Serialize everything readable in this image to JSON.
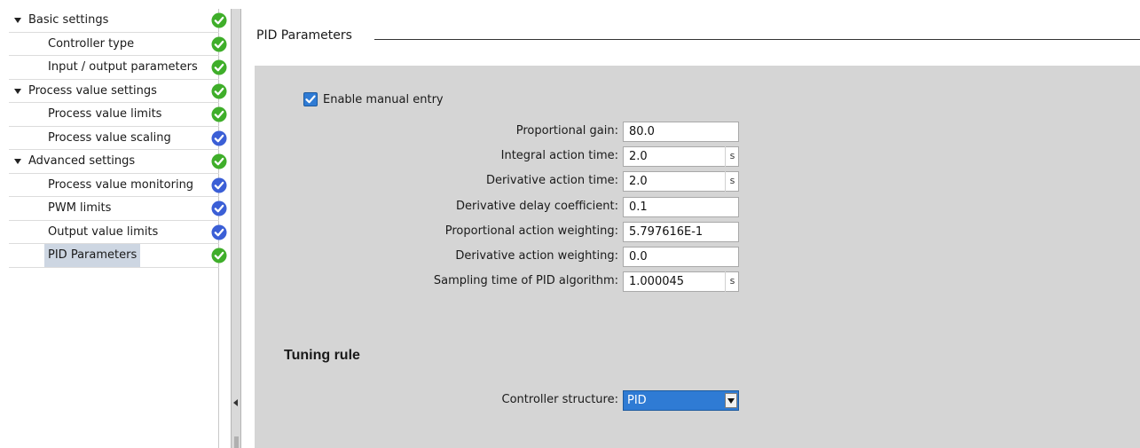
{
  "nav": {
    "items": [
      {
        "label": "Basic settings",
        "level": 0,
        "expanded": true,
        "status": "ok"
      },
      {
        "label": "Controller type",
        "level": 1,
        "status": "ok"
      },
      {
        "label": "Input / output parameters",
        "level": 1,
        "status": "ok"
      },
      {
        "label": "Process value settings",
        "level": 0,
        "expanded": true,
        "status": "ok"
      },
      {
        "label": "Process value limits",
        "level": 1,
        "status": "ok"
      },
      {
        "label": "Process value scaling",
        "level": 1,
        "status": "info"
      },
      {
        "label": "Advanced settings",
        "level": 0,
        "expanded": true,
        "status": "ok"
      },
      {
        "label": "Process value monitoring",
        "level": 1,
        "status": "info"
      },
      {
        "label": "PWM limits",
        "level": 1,
        "status": "info"
      },
      {
        "label": "Output value limits",
        "level": 1,
        "status": "info"
      },
      {
        "label": "PID Parameters",
        "level": 1,
        "status": "ok",
        "selected": true
      }
    ]
  },
  "colors": {
    "status_ok": "#3fae2a",
    "status_info": "#3b5fd6",
    "accent": "#2f7bd4",
    "panel_bg": "#d5d5d5"
  },
  "section": {
    "title": "PID Parameters"
  },
  "manual_entry": {
    "label": "Enable manual entry",
    "checked": true
  },
  "fields": [
    {
      "label": "Proportional gain:",
      "value": "80.0",
      "unit": ""
    },
    {
      "label": "Integral action time:",
      "value": "2.0",
      "unit": "s"
    },
    {
      "label": "Derivative action time:",
      "value": "2.0",
      "unit": "s"
    },
    {
      "label": "Derivative delay coefficient:",
      "value": "0.1",
      "unit": ""
    },
    {
      "label": "Proportional action weighting:",
      "value": "5.797616E-1",
      "unit": ""
    },
    {
      "label": "Derivative action weighting:",
      "value": "0.0",
      "unit": ""
    },
    {
      "label": "Sampling time of PID algorithm:",
      "value": "1.000045",
      "unit": "s"
    }
  ],
  "tuning": {
    "title": "Tuning rule",
    "structure_label": "Controller structure:",
    "structure_value": "PID"
  }
}
